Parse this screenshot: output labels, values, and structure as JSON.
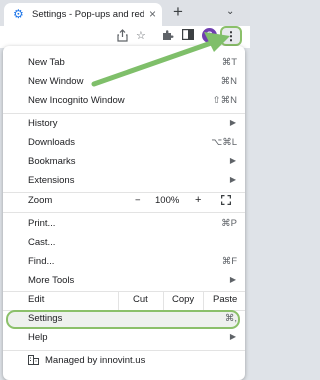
{
  "tab": {
    "title": "Settings - Pop-ups and redirects",
    "icon": "gear-icon",
    "close_glyph": "×"
  },
  "tabstrip": {
    "new_tab_glyph": "+",
    "tab_search_glyph": "⌄"
  },
  "toolbar": {
    "avatar_letter": "S",
    "accent_color": "#8bc06a"
  },
  "menu": {
    "new_tab": {
      "label": "New Tab",
      "shortcut": "⌘T"
    },
    "new_window": {
      "label": "New Window",
      "shortcut": "⌘N"
    },
    "new_incognito": {
      "label": "New Incognito Window",
      "shortcut": "⇧⌘N"
    },
    "history": {
      "label": "History"
    },
    "downloads": {
      "label": "Downloads",
      "shortcut": "⌥⌘L"
    },
    "bookmarks": {
      "label": "Bookmarks"
    },
    "extensions": {
      "label": "Extensions"
    },
    "zoom": {
      "label": "Zoom",
      "minus": "−",
      "value": "100%",
      "plus": "+"
    },
    "print": {
      "label": "Print...",
      "shortcut": "⌘P"
    },
    "cast": {
      "label": "Cast..."
    },
    "find": {
      "label": "Find...",
      "shortcut": "⌘F"
    },
    "more_tools": {
      "label": "More Tools"
    },
    "edit": {
      "label": "Edit",
      "cut": "Cut",
      "copy": "Copy",
      "paste": "Paste"
    },
    "settings": {
      "label": "Settings",
      "shortcut": "⌘,"
    },
    "help": {
      "label": "Help"
    },
    "managed": {
      "label": "Managed by innovint.us"
    }
  }
}
